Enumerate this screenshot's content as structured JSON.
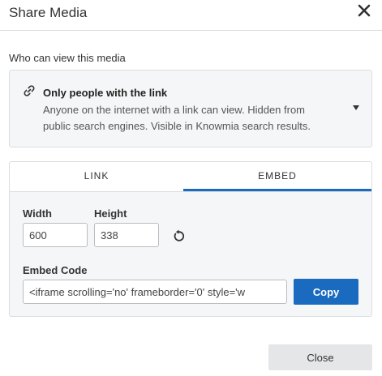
{
  "dialog": {
    "title": "Share Media",
    "close_icon": "close-icon"
  },
  "privacy": {
    "section_label": "Who can view this media",
    "option_title": "Only people with the link",
    "option_description": "Anyone on the internet with a link can view. Hidden from public search engines. Visible in Knowmia search results.",
    "icon": "link-icon"
  },
  "tabs": [
    {
      "label": "LINK",
      "active": false
    },
    {
      "label": "EMBED",
      "active": true
    }
  ],
  "embed": {
    "width_label": "Width",
    "width_value": "600",
    "height_label": "Height",
    "height_value": "338",
    "reset_icon": "reset-icon",
    "code_label": "Embed Code",
    "code_value": "<iframe scrolling='no' frameborder='0' style='w",
    "copy_label": "Copy"
  },
  "footer": {
    "close_label": "Close"
  },
  "colors": {
    "accent": "#1a6bbf",
    "panel_bg": "#f5f6f7",
    "close_button_bg": "#e4e6e8"
  }
}
